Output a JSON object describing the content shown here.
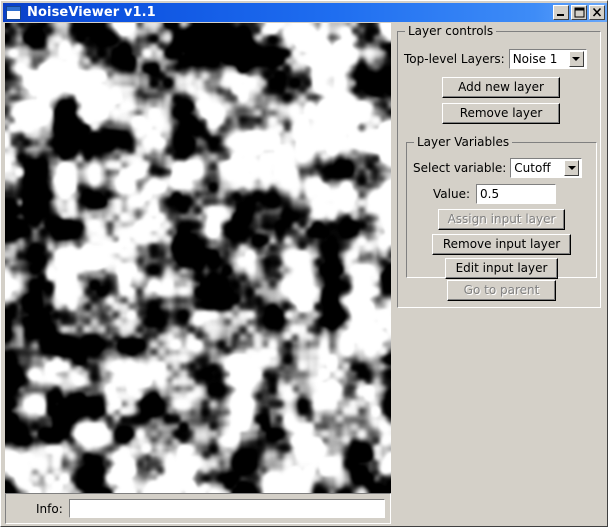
{
  "window": {
    "title": "NoiseViewer v1.1",
    "icon": "window-icon",
    "controls": [
      {
        "name": "minimize-button",
        "glyph": "minimize-icon"
      },
      {
        "name": "maximize-button",
        "glyph": "maximize-icon"
      },
      {
        "name": "close-button",
        "glyph": "close-icon"
      }
    ],
    "titlebar_color": "#1f6ef0",
    "panel_color": "#d4d0c8"
  },
  "canvas": {
    "name": "noise-preview",
    "background_color": "#000000",
    "foreground_color": "#ffffff",
    "description": "grayscale blurred noise field"
  },
  "info_bar": {
    "label": "Info:",
    "value": "",
    "placeholder": ""
  },
  "layer_controls": {
    "legend": "Layer controls",
    "top_level_label": "Top-level Layers:",
    "top_level_value": "Noise 1",
    "add_layer_label": "Add new layer",
    "remove_layer_label": "Remove layer",
    "go_to_parent_label": "Go to parent",
    "go_to_parent_enabled": false
  },
  "layer_variables": {
    "legend": "Layer Variables",
    "select_variable_label": "Select variable:",
    "select_variable_value": "Cutoff",
    "value_label": "Value:",
    "value": "0.5",
    "assign_input_label": "Assign input layer",
    "assign_input_enabled": false,
    "remove_input_label": "Remove input layer",
    "remove_input_enabled": true,
    "edit_input_label": "Edit input layer",
    "edit_input_enabled": true
  }
}
